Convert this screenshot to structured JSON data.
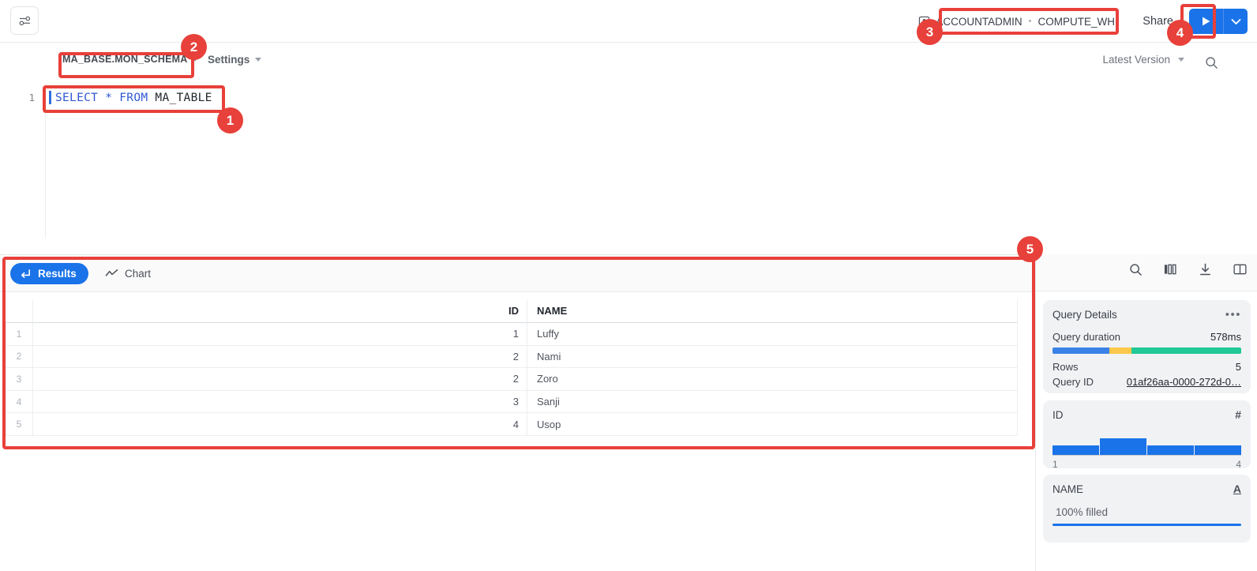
{
  "topbar": {
    "sliders_icon": "sliders-icon",
    "role": "ACCOUNTADMIN",
    "role_separator": "•",
    "warehouse": "COMPUTE_WH",
    "share_label": "Share",
    "run_icon": "play-icon",
    "run_caret_icon": "chevron-down-icon"
  },
  "editor_toolbar": {
    "database_schema": "MA_BASE.MON_SCHEMA",
    "settings_label": "Settings",
    "version_label": "Latest Version",
    "search_icon": "search-icon"
  },
  "editor": {
    "line_number": "1",
    "code_keyword_part": "SELECT * FROM ",
    "code_identifier_part": "MA_TABLE"
  },
  "results": {
    "tab_results": "Results",
    "tab_chart": "Chart",
    "results_icon": "return-arrow-icon",
    "chart_icon": "line-chart-icon",
    "tools": [
      {
        "name": "search-icon",
        "glyph": "search"
      },
      {
        "name": "columns-icon",
        "glyph": "columns"
      },
      {
        "name": "download-icon",
        "glyph": "download"
      },
      {
        "name": "split-panel-icon",
        "glyph": "panel"
      }
    ],
    "columns": [
      "",
      "ID",
      "NAME"
    ],
    "rows": [
      {
        "n": "1",
        "id": "1",
        "name": "Luffy"
      },
      {
        "n": "2",
        "id": "2",
        "name": "Nami"
      },
      {
        "n": "3",
        "id": "2",
        "name": "Zoro"
      },
      {
        "n": "4",
        "id": "3",
        "name": "Sanji"
      },
      {
        "n": "5",
        "id": "4",
        "name": "Usop"
      }
    ]
  },
  "details": {
    "title": "Query Details",
    "more_label": "•••",
    "duration_label": "Query duration",
    "duration_value": "578ms",
    "duration_segments": [
      {
        "color": "#3b82e8",
        "pct": 30
      },
      {
        "color": "#fbc84b",
        "pct": 12
      },
      {
        "color": "#20c997",
        "pct": 58
      }
    ],
    "rows_label": "Rows",
    "rows_value": "5",
    "query_id_label": "Query ID",
    "query_id_value": "01af26aa-0000-272d-0…",
    "id_card": {
      "title": "ID",
      "type_glyph": "#",
      "bars": [
        0.55,
        1.0,
        0.55,
        0.55
      ],
      "min_label": "1",
      "max_label": "4"
    },
    "name_card": {
      "title": "NAME",
      "type_glyph": "A",
      "fill_label": "100% filled",
      "fill_pct": 100
    }
  },
  "annotations": [
    {
      "number": "1",
      "target": "sql-editor-line"
    },
    {
      "number": "2",
      "target": "database-schema-selector"
    },
    {
      "number": "3",
      "target": "role-warehouse-chip"
    },
    {
      "number": "4",
      "target": "run-query-button"
    },
    {
      "number": "5",
      "target": "results-panel"
    }
  ],
  "colors": {
    "accent_blue": "#1a73e8",
    "annotation_red": "#e8403a",
    "sql_keyword": "#2f57d4"
  }
}
